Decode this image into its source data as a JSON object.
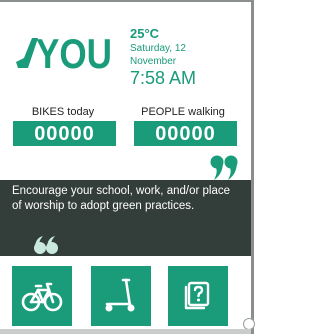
{
  "brand": {
    "logo_text": "YOU"
  },
  "weather": {
    "temperature": "25°C",
    "day": "Saturday, 12",
    "month": "November",
    "time": "7:58 AM"
  },
  "counters": {
    "bikes": {
      "label": "BIKES today",
      "value": "00000"
    },
    "people": {
      "label": "PEOPLE walking",
      "value": "00000"
    }
  },
  "quote": {
    "text": "Encourage your school, work, and/or place of worship to adopt green practices."
  },
  "tiles": [
    {
      "icon": "bicycle-icon"
    },
    {
      "icon": "scooter-icon"
    },
    {
      "icon": "quiz-icon"
    }
  ],
  "colors": {
    "accent": "#1a9b7a",
    "dark_panel": "#333d3a",
    "quote_mark": "#1a9b7a"
  }
}
